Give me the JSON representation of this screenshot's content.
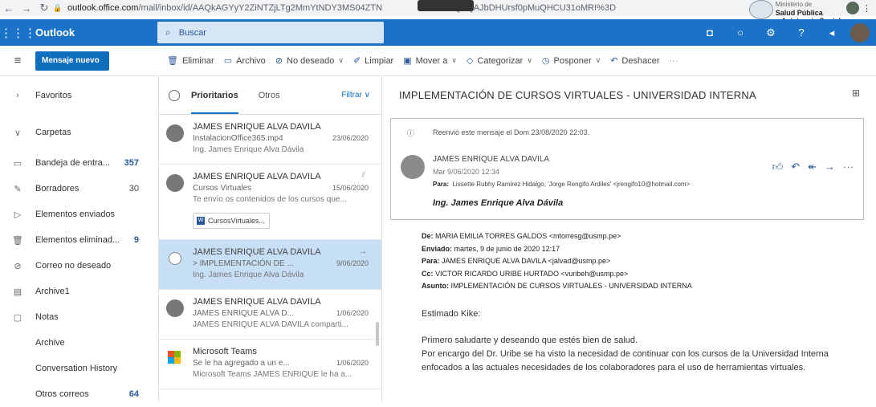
{
  "browser": {
    "url_prefix": "outlook.office.com",
    "url_rest": "/mail/inbox/id/AAQkAGYyY2ZiNTZjLTg2MmYtNDY3MS04ZTN",
    "url_tail": "MzliOQAQAJbDHUrsf0pMuQHCU31oMRI%3D"
  },
  "watermark": {
    "line1": "Ministerio de",
    "line2": "Salud Pública",
    "line3": "y Asistencia Social"
  },
  "suite": {
    "brand": "Outlook",
    "search_placeholder": "Buscar"
  },
  "commands": {
    "new_message": "Mensaje nuevo",
    "items": [
      {
        "label": "Eliminar",
        "icon": "trash-icon"
      },
      {
        "label": "Archivo",
        "icon": "archive-icon"
      },
      {
        "label": "No deseado",
        "icon": "block-icon"
      },
      {
        "label": "Limpiar",
        "icon": "sweep-icon"
      },
      {
        "label": "Mover a",
        "icon": "move-icon"
      },
      {
        "label": "Categorizar",
        "icon": "tag-icon"
      },
      {
        "label": "Posponer",
        "icon": "clock-icon"
      },
      {
        "label": "Deshacer",
        "icon": "undo-icon"
      }
    ]
  },
  "nav": {
    "favorites": "Favoritos",
    "folders": "Carpetas",
    "items": [
      {
        "label": "Bandeja de entra...",
        "count": "357"
      },
      {
        "label": "Borradores",
        "count": "30"
      },
      {
        "label": "Elementos enviados",
        "count": ""
      },
      {
        "label": "Elementos eliminad...",
        "count": "9"
      },
      {
        "label": "Correo no deseado",
        "count": ""
      },
      {
        "label": "Archive1",
        "count": ""
      },
      {
        "label": "Notas",
        "count": ""
      },
      {
        "label": "Archive",
        "count": ""
      },
      {
        "label": "Conversation History",
        "count": ""
      },
      {
        "label": "Otros correos",
        "count": "64"
      }
    ]
  },
  "list": {
    "tab_focused": "Prioritarios",
    "tab_other": "Otros",
    "filter": "Filtrar",
    "messages": [
      {
        "from": "JAMES ENRIQUE ALVA DAVILA",
        "subject": "InstalacionOffice365.mp4",
        "date": "23/06/2020",
        "preview": "Ing. James Enrique Alva Dávila"
      },
      {
        "from": "JAMES ENRIQUE ALVA DAVILA",
        "subject": "Cursos Virtuales",
        "date": "15/06/2020",
        "preview": "Te envío os contenidos de los cursos que...",
        "attachment": "CursosVirtuales..."
      },
      {
        "from": "JAMES ENRIQUE ALVA DAVILA",
        "subject": "> IMPLEMENTACIÓN DE ...",
        "date": "9/06/2020",
        "preview": "Ing. James Enrique Alva Dávila"
      },
      {
        "from": "JAMES ENRIQUE ALVA DAVILA",
        "subject": "JAMES ENRIQUE ALVA D...",
        "date": "1/06/2020",
        "preview": "JAMES ENRIQUE ALVA DAVILA comparti..."
      },
      {
        "from": "Microsoft Teams",
        "subject": "Se le ha agregado a un e...",
        "date": "1/06/2020",
        "preview": "Microsoft Teams JAMES ENRIQUE le ha a..."
      }
    ]
  },
  "reading": {
    "title": "IMPLEMENTACIÓN DE CURSOS VIRTUALES - UNIVERSIDAD INTERNA",
    "forward_note": "Reenvió este mensaje el Dom 23/08/2020 22:03.",
    "sender": "JAMES ENRIQUE ALVA DAVILA",
    "sent": "Mar 9/06/2020 12:34",
    "to_label": "Para:",
    "to": "Lissette Rubhy Ramirez Hidalgo; 'Jorge Rengifo Ardiles' <jrengifo10@hotmail.com>",
    "signature": "Ing. James Enrique Alva Dávila",
    "header": {
      "from_label": "De:",
      "from": "MARIA EMILIA TORRES GALDOS <mtorresg@usmp.pe>",
      "sent_label": "Enviado:",
      "sent": "martes, 9 de junio de 2020 12:17",
      "to_label": "Para:",
      "to": "JAMES ENRIQUE ALVA DAVILA <jalvad@usmp.pe>",
      "cc_label": "Cc:",
      "cc": "VICTOR RICARDO URIBE HURTADO <vuribeh@usmp.pe>",
      "subject_label": "Asunto:",
      "subject": "IMPLEMENTACIÓN DE CURSOS VIRTUALES - UNIVERSIDAD INTERNA"
    },
    "greeting": "Estimado Kike:",
    "line1": "Primero saludarte y deseando que estés bien de salud.",
    "line2": "Por encargo del Dr. Uribe se ha visto la necesidad de continuar con los cursos de la Universidad Interna enfocados a las actuales necesidades de los colaboradores para el uso de herramientas virtuales."
  }
}
